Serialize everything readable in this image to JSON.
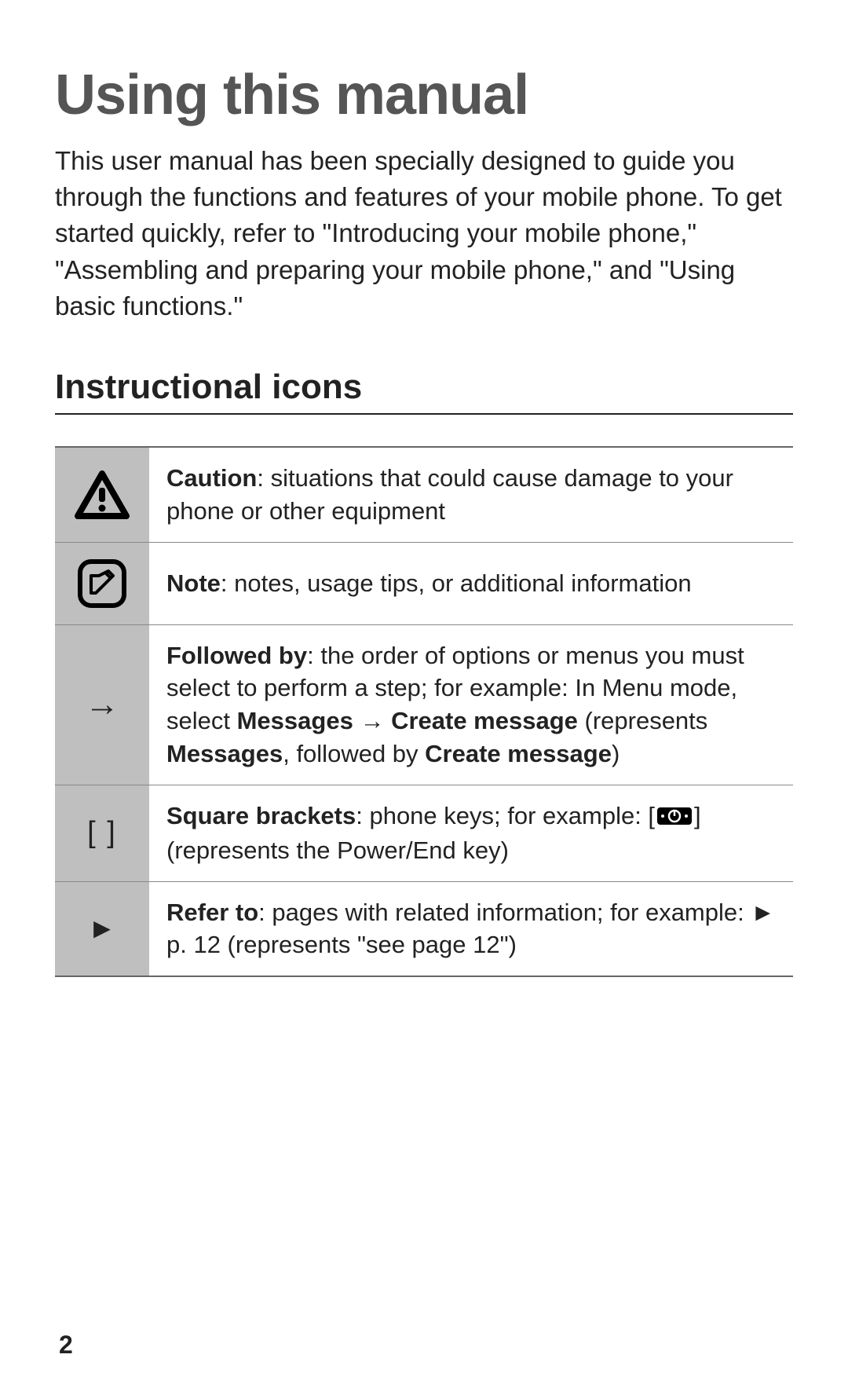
{
  "title": "Using this manual",
  "intro": "This user manual has been specially designed to guide you through the functions and features of your mobile phone. To get started quickly, refer to \"Introducing your mobile phone,\" \"Assembling and preparing your mobile phone,\" and \"Using basic functions.\"",
  "section_heading": "Instructional icons",
  "table": {
    "rows": [
      {
        "icon_name": "caution-icon",
        "label_bold": "Caution",
        "desc_after": ": situations that could cause damage to your phone or other equipment"
      },
      {
        "icon_name": "note-icon",
        "label_bold": "Note",
        "desc_after": ": notes, usage tips, or additional information"
      },
      {
        "icon_name": "arrow-right-icon",
        "symbol": "→",
        "label_bold": "Followed by",
        "desc_after_1": ": the order of options or menus you must select to perform a step; for example: In Menu mode, select ",
        "bold_2": "Messages",
        "desc_mid_1": " → ",
        "bold_3": "Create message",
        "desc_mid_2": " (represents ",
        "bold_4": "Messages",
        "desc_mid_3": ", followed by ",
        "bold_5": "Create message",
        "desc_after_2": ")"
      },
      {
        "icon_name": "brackets-icon",
        "symbol": "[   ]",
        "label_bold": "Square brackets",
        "desc_after_1": ": phone keys; for example: [",
        "desc_after_2": "] (represents the Power/End key)"
      },
      {
        "icon_name": "refer-to-icon",
        "symbol": "►",
        "label_bold": "Refer to",
        "desc_after_1": ": pages with related information; for example: ► p. 12 (represents \"see page 12\")"
      }
    ]
  },
  "page_number": "2"
}
